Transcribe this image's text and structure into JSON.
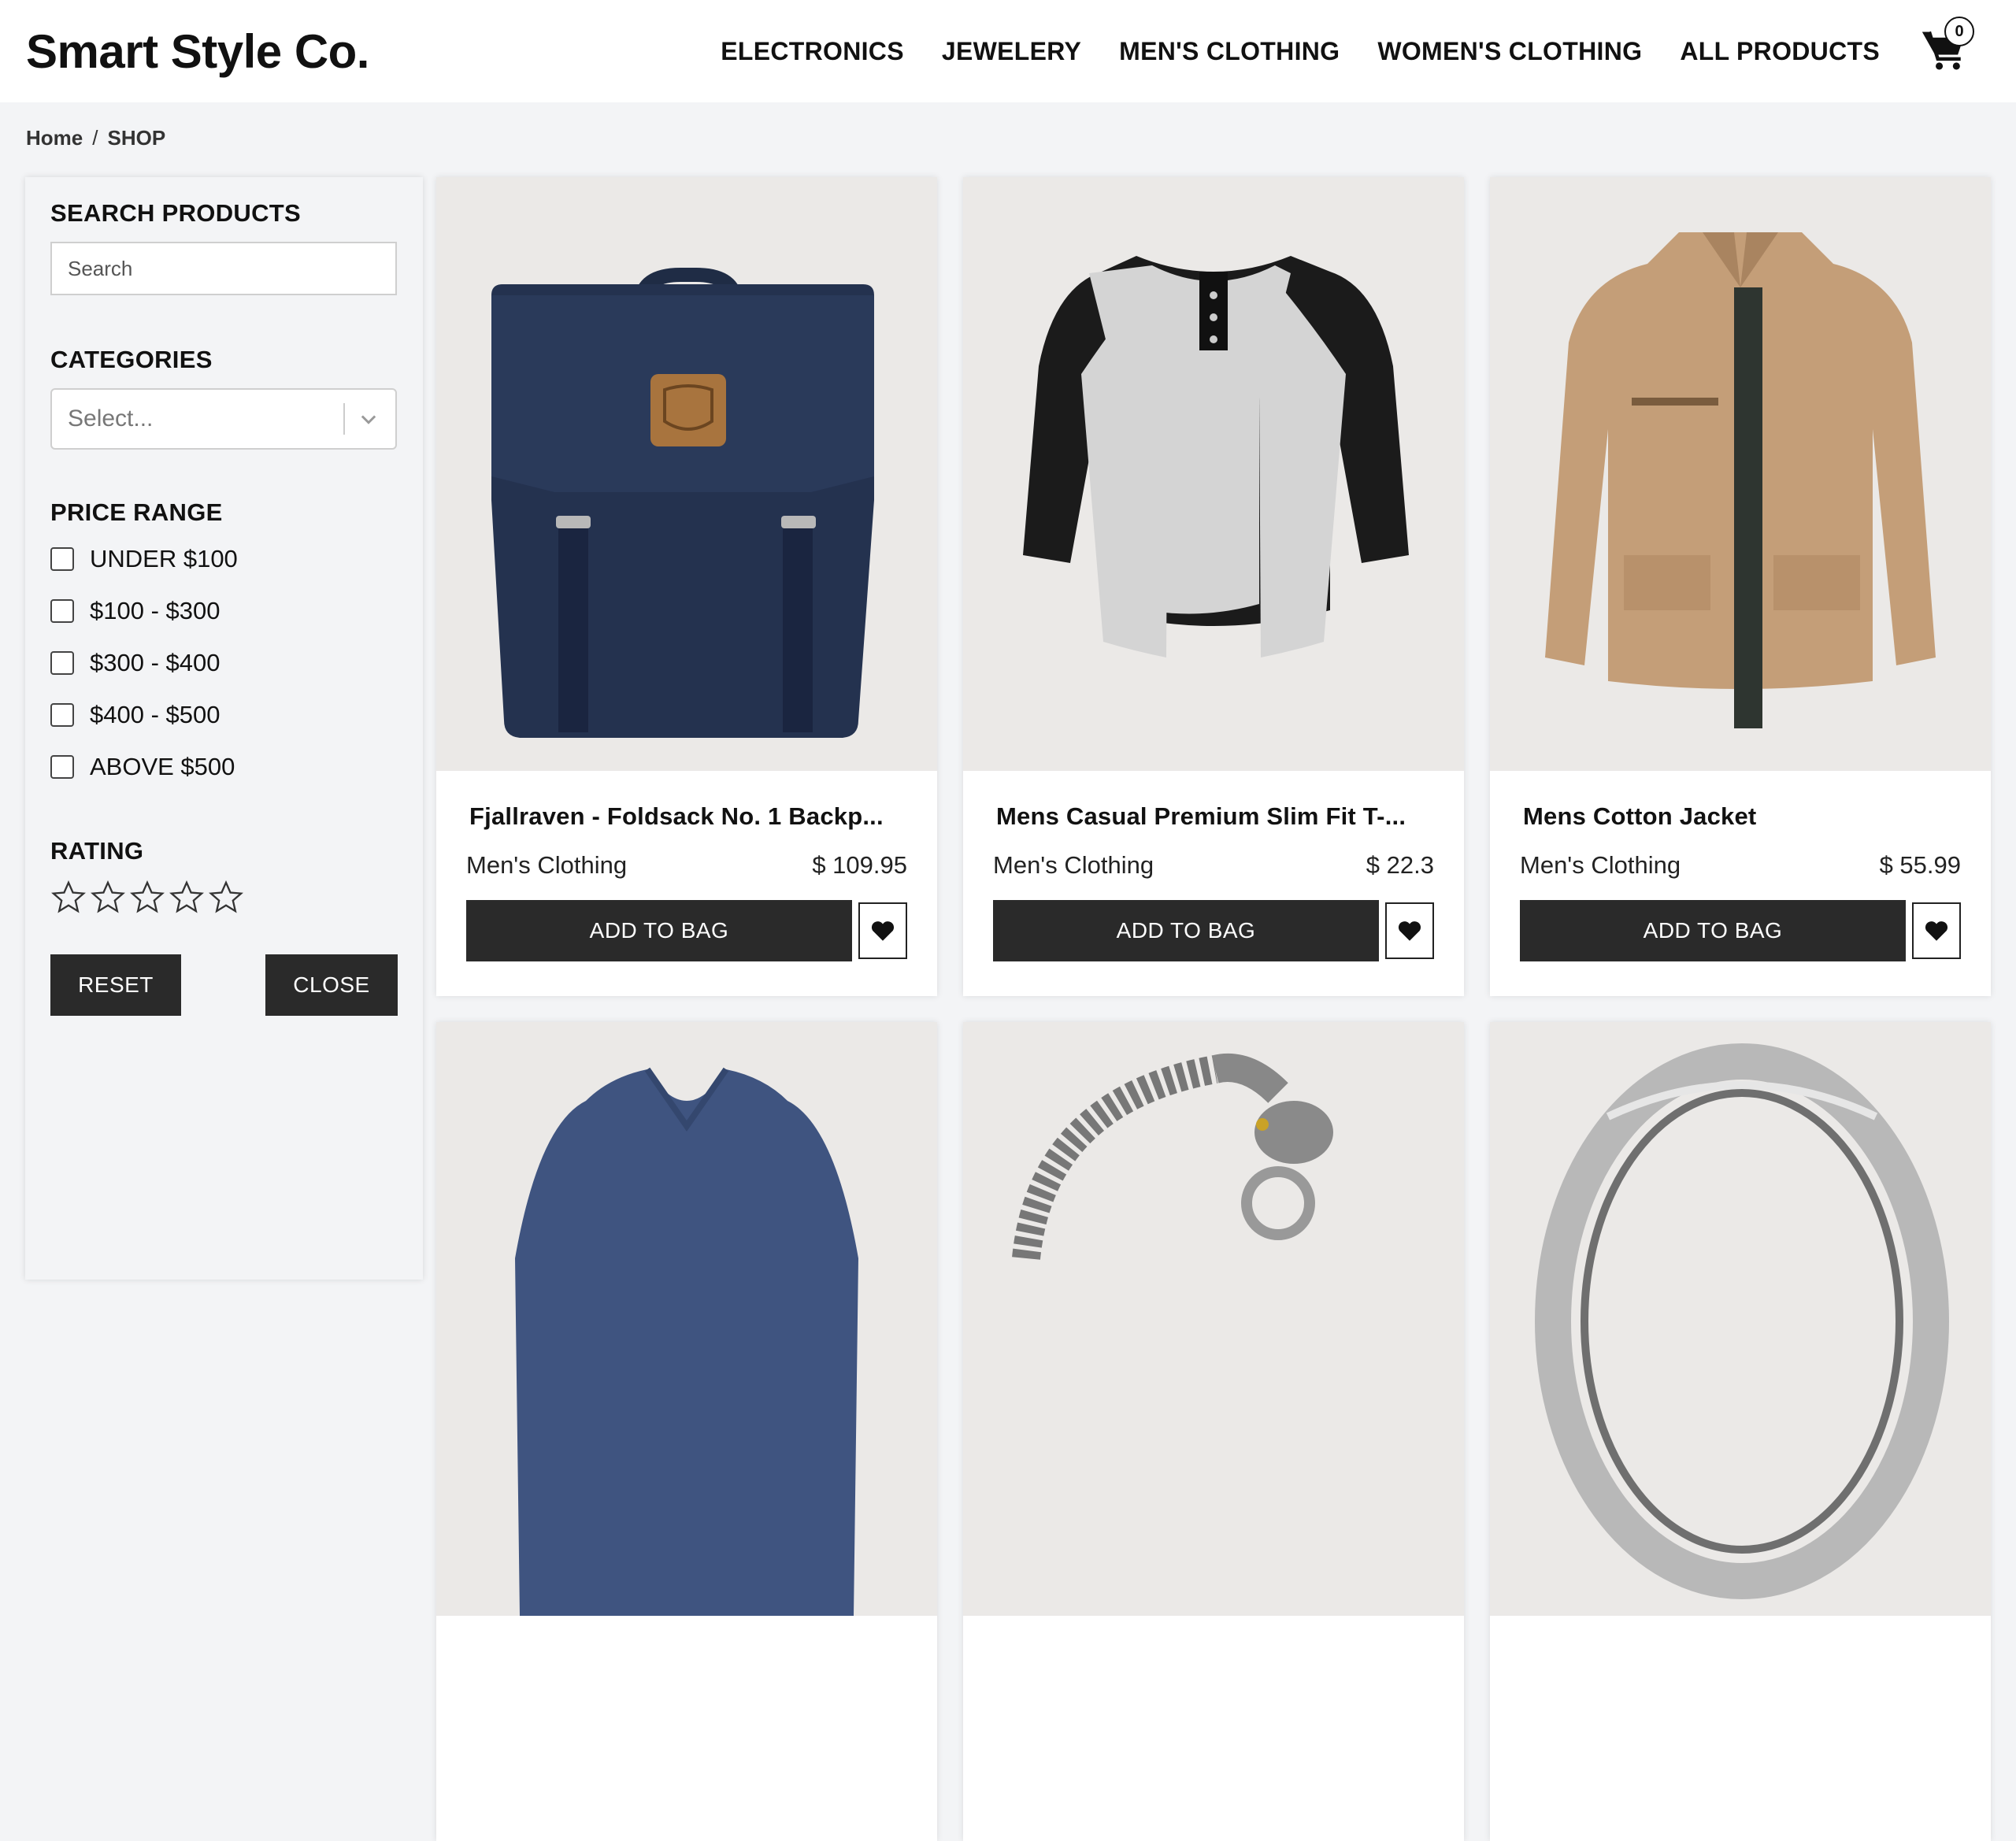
{
  "header": {
    "brand": "Smart Style Co.",
    "nav": [
      "ELECTRONICS",
      "JEWELERY",
      "MEN'S CLOTHING",
      "WOMEN'S CLOTHING",
      "ALL PRODUCTS"
    ],
    "cart_count": "0",
    "cart_icon": "shopping-cart-icon"
  },
  "breadcrumb": {
    "home": "Home",
    "separator": "/",
    "current": "SHOP"
  },
  "sidebar": {
    "search_heading": "SEARCH PRODUCTS",
    "search_placeholder": "Search",
    "categories_heading": "CATEGORIES",
    "categories_placeholder": "Select...",
    "price_heading": "PRICE RANGE",
    "price_options": [
      "UNDER $100",
      "$100 - $300",
      "$300 - $400",
      "$400 - $500",
      "ABOVE $500"
    ],
    "rating_heading": "RATING",
    "rating_value": 0,
    "rating_max": 5,
    "reset_label": "RESET",
    "close_label": "CLOSE"
  },
  "products": [
    {
      "title": "Fjallraven - Foldsack No. 1 Backp...",
      "category": "Men's Clothing",
      "price": "$ 109.95",
      "image": "backpack"
    },
    {
      "title": "Mens Casual Premium Slim Fit T-...",
      "category": "Men's Clothing",
      "price": "$ 22.3",
      "image": "raglan-tee"
    },
    {
      "title": "Mens Cotton Jacket",
      "category": "Men's Clothing",
      "price": "$ 55.99",
      "image": "jacket"
    },
    {
      "title": "",
      "category": "",
      "price": "",
      "image": "vneck-tee"
    },
    {
      "title": "",
      "category": "",
      "price": "",
      "image": "dragon-bracelet"
    },
    {
      "title": "",
      "category": "",
      "price": "",
      "image": "silver-ring"
    }
  ],
  "add_to_bag_label": "ADD TO BAG",
  "colors": {
    "dark": "#2a2a2a",
    "page_bg": "#f3f4f6",
    "image_bg": "#ebe9e7"
  }
}
